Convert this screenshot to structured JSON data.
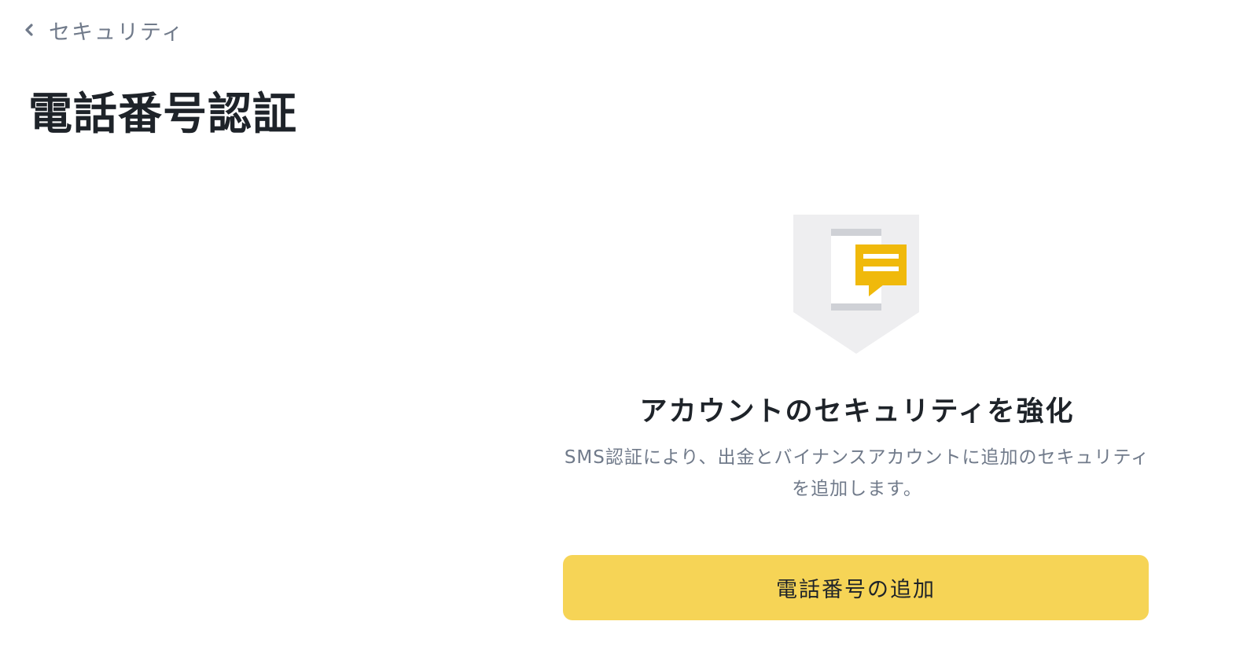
{
  "nav": {
    "back_label": "セキュリティ",
    "back_icon": "chevron-left-icon"
  },
  "page": {
    "title": "電話番号認証"
  },
  "illustration": {
    "icon": "phone-sms-shield-icon",
    "colors": {
      "shield": "#eeeef0",
      "phone_screen": "#ffffff",
      "phone_bars": "#cfd1d6",
      "message_bubble": "#f0b90b"
    }
  },
  "main": {
    "headline": "アカウントのセキュリティを強化",
    "description": "SMS認証により、出金とバイナンスアカウントに追加のセキュリティを追加します。",
    "add_button_label": "電話番号の追加"
  },
  "colors": {
    "accent": "#f6d456",
    "text_primary": "#1e2329",
    "text_secondary": "#707a8a"
  }
}
